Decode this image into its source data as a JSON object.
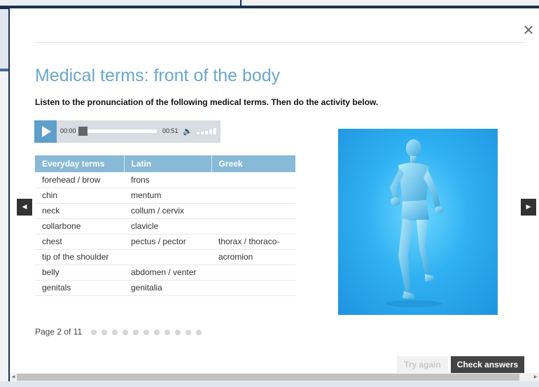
{
  "modal": {
    "close_glyph": "✕",
    "title": "Medical terms: front of the body",
    "instructions": "Listen to the pronunciation of the following medical terms. Then do the activity below."
  },
  "audio_player": {
    "current_time": "00:00",
    "duration": "00:51",
    "progress_fraction": 0.0,
    "volume_icon": "speaker-icon",
    "volume_glyph": "🔉"
  },
  "table": {
    "headers": [
      "Everyday terms",
      "Latin",
      "Greek"
    ],
    "rows": [
      [
        "forehead / brow",
        "frons",
        ""
      ],
      [
        "chin",
        "mentum",
        ""
      ],
      [
        "neck",
        "collum / cervix",
        ""
      ],
      [
        "collarbone",
        "clavicle",
        ""
      ],
      [
        "chest",
        "pectus / pector",
        "thorax / thoraco-"
      ],
      [
        "tip of the shoulder",
        "",
        "acromion"
      ],
      [
        "belly",
        "abdomen / venter",
        ""
      ],
      [
        "genitals",
        "genitalia",
        ""
      ]
    ]
  },
  "image": {
    "description_icon": "running-man-anatomy-image"
  },
  "pagination": {
    "label": "Page 2 of 11",
    "total_pages": 11,
    "current_page": 2
  },
  "navigation": {
    "prev_glyph": "◀",
    "next_glyph": "▶"
  },
  "buttons": {
    "try_again": "Try again",
    "check_answers": "Check answers"
  },
  "colors": {
    "title": "#6aa7c8",
    "table_header": "#88b9d6",
    "accent": "#5f9fcc",
    "image_bg": "#2fb1f2"
  }
}
